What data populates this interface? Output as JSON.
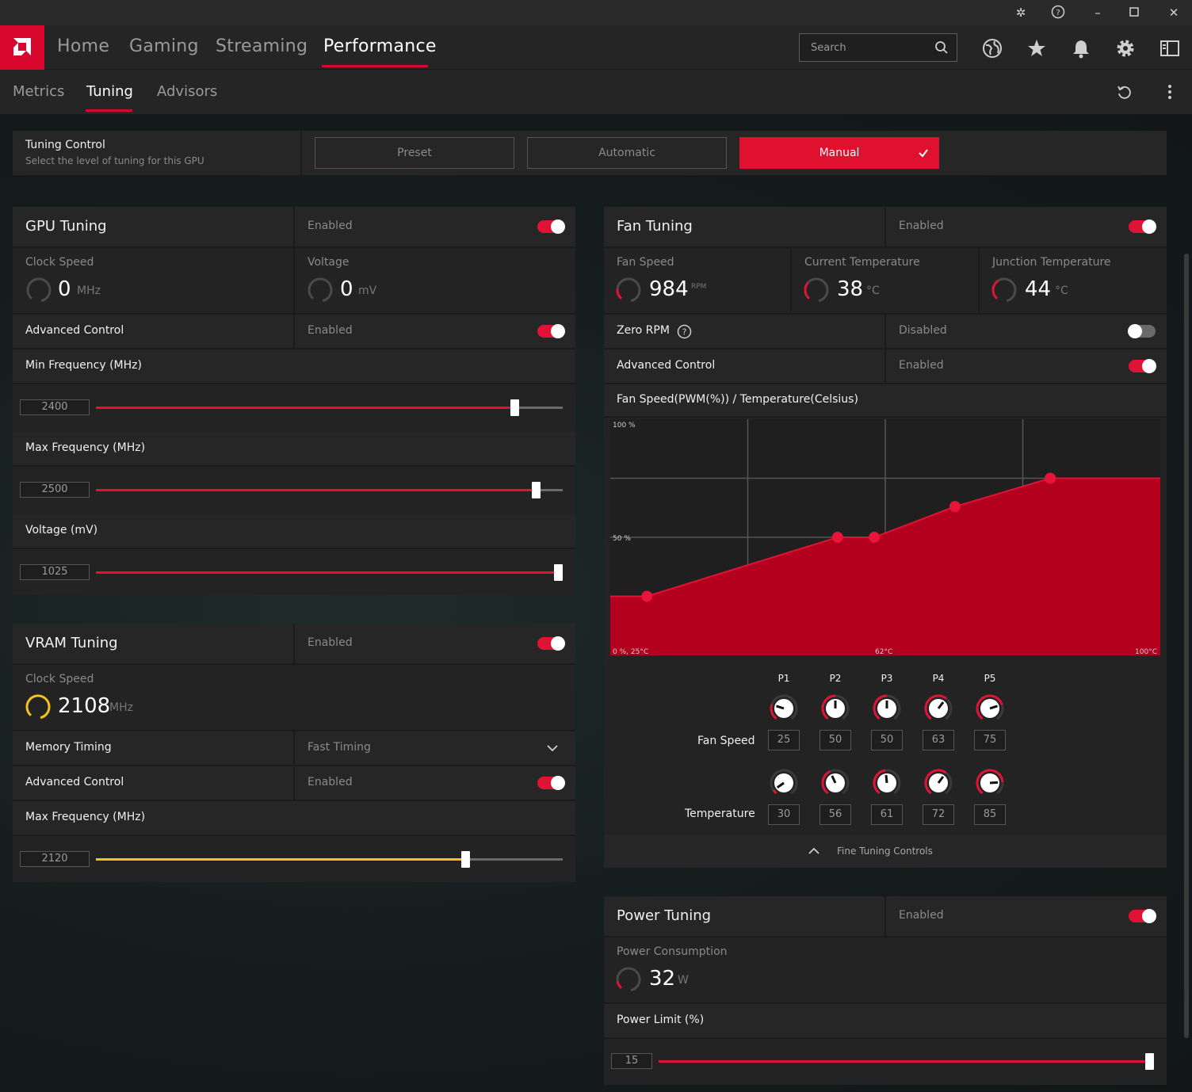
{
  "nav": {
    "tabs": [
      "Home",
      "Gaming",
      "Streaming",
      "Performance"
    ],
    "search_placeholder": "Search"
  },
  "subnav": {
    "tabs": [
      "Metrics",
      "Tuning",
      "Advisors"
    ]
  },
  "tuning_control": {
    "title": "Tuning Control",
    "subtitle": "Select the level of tuning for this GPU",
    "buttons": [
      "Preset",
      "Automatic",
      "Manual"
    ]
  },
  "gpu": {
    "title": "GPU Tuning",
    "status": "Enabled",
    "clock_label": "Clock Speed",
    "clock_value": "0",
    "clock_unit": "MHz",
    "voltage_label": "Voltage",
    "voltage_value": "0",
    "voltage_unit": "mV",
    "adv_label": "Advanced Control",
    "adv_status": "Enabled",
    "min_label": "Min Frequency (MHz)",
    "min_value": "2400",
    "max_label": "Max Frequency (MHz)",
    "max_value": "2500",
    "volt_label": "Voltage (mV)",
    "volt_value": "1025",
    "sliders": {
      "min": 0.896,
      "max": 0.943,
      "volt": 0.99
    }
  },
  "vram": {
    "title": "VRAM Tuning",
    "status": "Enabled",
    "clock_label": "Clock Speed",
    "clock_value": "2108",
    "clock_unit": "MHz",
    "timing_label": "Memory Timing",
    "timing_value": "Fast Timing",
    "adv_label": "Advanced Control",
    "adv_status": "Enabled",
    "max_label": "Max Frequency (MHz)",
    "max_value": "2120",
    "slider": 0.792
  },
  "fan": {
    "title": "Fan Tuning",
    "status": "Enabled",
    "speed_label": "Fan Speed",
    "speed_value": "984",
    "speed_unit": "RPM",
    "temp_label": "Current Temperature",
    "temp_value": "38",
    "temp_unit": "°C",
    "junction_label": "Junction Temperature",
    "junction_value": "44",
    "junction_unit": "°C",
    "zero_label": "Zero RPM",
    "zero_status": "Disabled",
    "adv_label": "Advanced Control",
    "adv_status": "Enabled",
    "curve_title": "Fan Speed(PWM(%)) / Temperature(Celsius)",
    "y_top": "100 %",
    "y_mid": "50 %",
    "x_left": "0 %, 25°C",
    "x_mid": "62°C",
    "x_right": "100°C",
    "row_speed": "Fan Speed",
    "row_temp": "Temperature",
    "fine_tuning": "Fine Tuning Controls"
  },
  "chart_data": {
    "type": "area",
    "x": [
      30,
      56,
      61,
      72,
      85
    ],
    "values": [
      25,
      50,
      50,
      63,
      75
    ],
    "point_labels": [
      "P1",
      "P2",
      "P3",
      "P4",
      "P5"
    ],
    "xlim": [
      25,
      100
    ],
    "ylim": [
      0,
      100
    ]
  },
  "power": {
    "title": "Power Tuning",
    "status": "Enabled",
    "consumption_label": "Power Consumption",
    "consumption_value": "32",
    "consumption_unit": "W",
    "limit_label": "Power Limit (%)",
    "limit_value": "15",
    "slider": 0.99
  },
  "colors": {
    "accent": "#e0102f",
    "vram": "#f5c11a"
  }
}
